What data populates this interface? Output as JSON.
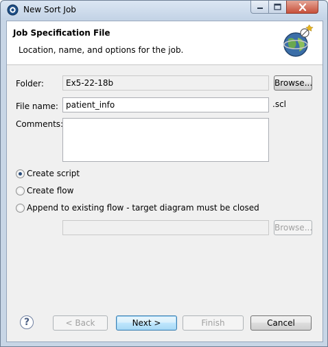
{
  "window": {
    "title": "New Sort Job"
  },
  "header": {
    "title": "Job Specification File",
    "description": "Location, name, and options for the job."
  },
  "form": {
    "folder_label": "Folder:",
    "folder_value": "Ex5-22-18b",
    "browse_label": "Browse...",
    "filename_label": "File name:",
    "filename_value": "patient_info",
    "filename_ext": ".scl",
    "comments_label": "Comments:",
    "comments_value": "",
    "options": [
      {
        "label": "Create script",
        "checked": true
      },
      {
        "label": "Create flow",
        "checked": false
      },
      {
        "label": "Append to existing flow - target diagram must be closed",
        "checked": false
      }
    ],
    "flow_value": "",
    "flow_browse_label": "Browse..."
  },
  "footer": {
    "help_label": "?",
    "back_label": "< Back",
    "next_label": "Next >",
    "finish_label": "Finish",
    "cancel_label": "Cancel"
  }
}
